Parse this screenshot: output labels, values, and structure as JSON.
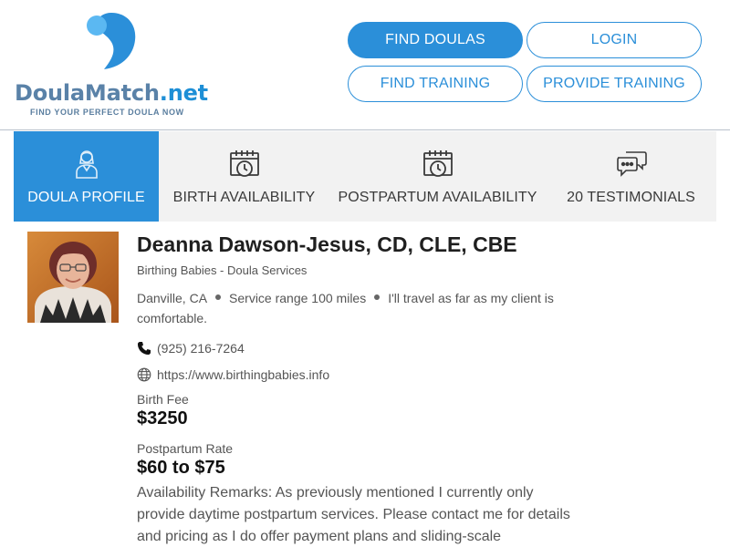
{
  "logo": {
    "name_main": "DoulaMatch",
    "name_suffix": ".net",
    "tagline": "FIND YOUR PERFECT DOULA NOW"
  },
  "nav": {
    "find_doulas": "FIND DOULAS",
    "login": "LOGIN",
    "find_training": "FIND TRAINING",
    "provide_training": "PROVIDE TRAINING"
  },
  "tabs": [
    {
      "label": "DOULA PROFILE",
      "icon": "doula-person-icon",
      "active": true
    },
    {
      "label": "BIRTH AVAILABILITY",
      "icon": "calendar-clock-icon",
      "active": false
    },
    {
      "label": "POSTPARTUM AVAILABILITY",
      "icon": "calendar-clock-icon",
      "active": false
    },
    {
      "label": "20 TESTIMONIALS",
      "icon": "chat-bubbles-icon",
      "active": false
    }
  ],
  "profile": {
    "name": "Deanna Dawson-Jesus, CD, CLE, CBE",
    "business": "Birthing Babies - Doula Services",
    "location_city": "Danville, CA",
    "service_range": "Service range 100 miles",
    "travel_note": "I'll travel as far as my client is comfortable.",
    "phone": "(925) 216-7264",
    "website": "https://www.birthingbabies.info",
    "birth_fee_label": "Birth Fee",
    "birth_fee": "$3250",
    "postpartum_label": "Postpartum Rate",
    "postpartum_rate": "$60 to $75",
    "remarks": "Availability Remarks: As previously mentioned I currently only provide daytime postpartum services. Please contact me for details and pricing as I do offer payment plans and sliding-scale"
  },
  "colors": {
    "accent": "#2b8fd9",
    "logo_text": "#5a82a8",
    "tab_bg": "#f2f2f2"
  }
}
